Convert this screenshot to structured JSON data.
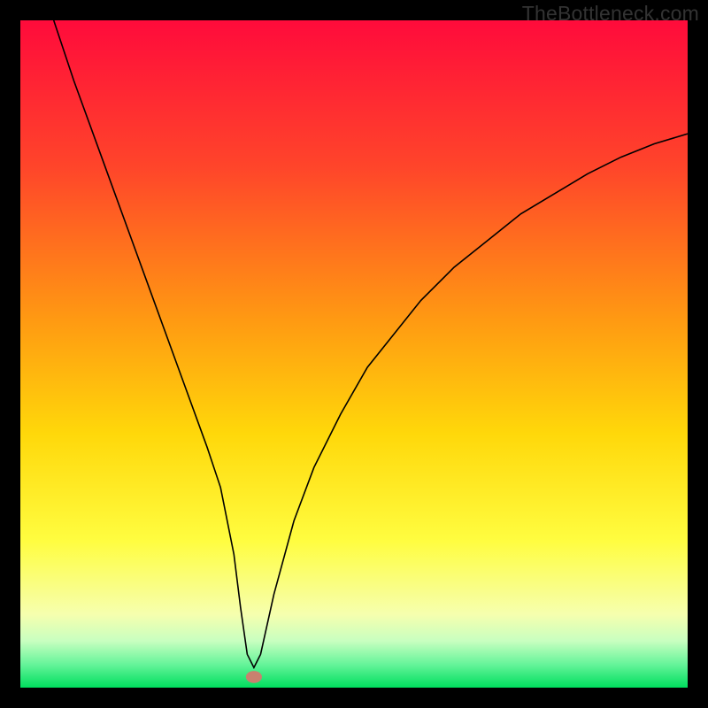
{
  "watermark": "TheBottleneck.com",
  "chart_data": {
    "type": "line",
    "title": "",
    "xlabel": "",
    "ylabel": "",
    "xlim": [
      0,
      100
    ],
    "ylim": [
      0,
      100
    ],
    "background_gradient_colors": [
      "#ff0b3b",
      "#ff6020",
      "#ffc60a",
      "#fffd40",
      "#f7ffb0",
      "#9cffb8",
      "#00de5e"
    ],
    "series": [
      {
        "name": "bottleneck-curve",
        "x": [
          5,
          8,
          12,
          16,
          20,
          24,
          28,
          30,
          32,
          33,
          34,
          35,
          36,
          38,
          41,
          44,
          48,
          52,
          56,
          60,
          65,
          70,
          75,
          80,
          85,
          90,
          95,
          100
        ],
        "y": [
          100,
          91,
          80,
          69,
          58,
          47,
          36,
          30,
          20,
          12,
          5,
          3,
          5,
          14,
          25,
          33,
          41,
          48,
          53,
          58,
          63,
          67,
          71,
          74,
          77,
          79.5,
          81.5,
          83
        ]
      }
    ],
    "marker": {
      "name": "optimal-point",
      "x": 35,
      "y": 1.6,
      "rx": 1.2,
      "ry": 0.9,
      "color": "#c9816f"
    }
  }
}
